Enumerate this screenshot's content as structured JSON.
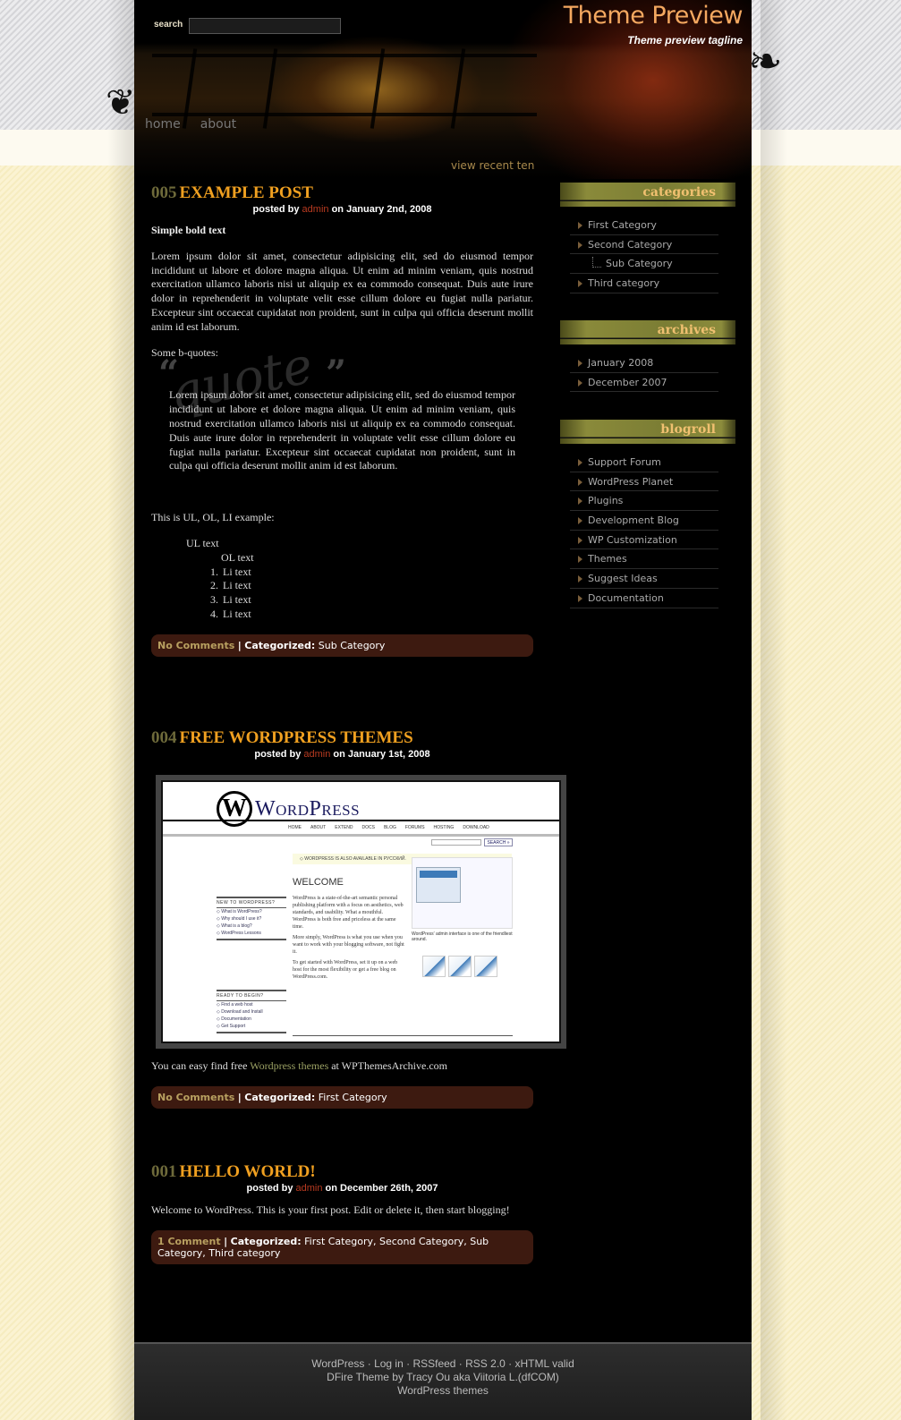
{
  "header": {
    "search_label": "search",
    "search_value": "",
    "site_title": "Theme Preview",
    "tagline": "Theme preview tagline",
    "nav": [
      {
        "label": "home"
      },
      {
        "label": "about"
      }
    ],
    "view_recent": "view recent ten"
  },
  "posts": [
    {
      "number": "005",
      "title": "EXAMPLE POST",
      "meta": {
        "prefix": "posted by",
        "author": "admin",
        "date_text": "on January 2nd, 2008"
      },
      "bold_text": "Simple bold text",
      "paragraph": "Lorem ipsum dolor sit amet, consectetur adipisicing elit, sed do eiusmod tempor incididunt ut labore et dolore magna aliqua. Ut enim ad minim veniam, quis nostrud exercitation ullamco laboris nisi ut aliquip ex ea commodo consequat. Duis aute irure dolor in reprehenderit in voluptate velit esse cillum dolore eu fugiat nulla pariatur. Excepteur sint occaecat cupidatat non proident, sunt in culpa qui officia deserunt mollit anim id est laborum.",
      "bquote_intro": "Some b-quotes:",
      "bquote_watermark": "quote",
      "bquote_text": "Lorem ipsum dolor sit amet, consectetur adipisicing elit, sed do eiusmod tempor incididunt ut labore et dolore magna aliqua. Ut enim ad minim veniam, quis nostrud exercitation ullamco laboris nisi ut aliquip ex ea commodo consequat. Duis aute irure dolor in reprehenderit in voluptate velit esse cillum dolore eu fugiat nulla pariatur. Excepteur sint occaecat cupidatat non proident, sunt in culpa qui officia deserunt mollit anim id est laborum.",
      "list_intro": "This is UL, OL, LI example:",
      "ul_text": "UL text",
      "ol_text": "OL text",
      "li_items": [
        "Li text",
        "Li text",
        "Li text",
        "Li text"
      ],
      "footer": {
        "comments": "No Comments",
        "categorized_label": "Categorized:",
        "categories": "Sub Category"
      }
    },
    {
      "number": "004",
      "title": "FREE WORDPRESS THEMES",
      "meta": {
        "prefix": "posted by",
        "author": "admin",
        "date_text": "on January 1st, 2008"
      },
      "screenshot": {
        "logo_text": "WordPress",
        "nav": [
          "HOME",
          "ABOUT",
          "EXTEND",
          "DOCS",
          "BLOG",
          "FORUMS",
          "HOSTING",
          "DOWNLOAD"
        ],
        "search_button": "SEARCH »",
        "notice": "◇ WORDPRESS IS ALSO AVAILABLE IN РУССКИЙ.",
        "welcome": "WELCOME",
        "body": [
          "WordPress is a state-of-the-art semantic personal publishing platform with a focus on aesthetics, web standards, and usability. What a mouthful. WordPress is both free and priceless at the same time.",
          "More simply, WordPress is what you use when you want to work with your blogging software, not fight it.",
          "To get started with WordPress, set it up on a web host for the most flexibility or get a free blog on WordPress.com."
        ],
        "side1_heading": "NEW TO WORDPRESS?",
        "side1_items": [
          "◇ What is WordPress?",
          "◇ Why should I use it?",
          "◇ What is a blog?",
          "◇ WordPress Lessons"
        ],
        "side2_heading": "READY TO BEGIN?",
        "side2_items": [
          "◇ Find a web host",
          "◇ Download and Install",
          "◇ Documentation",
          "◇ Get Support"
        ],
        "theme_caption": "WordPress' admin interface is one of the friendliest around."
      },
      "text_before": "You can easy find free",
      "link_text": "Wordpress themes",
      "text_after": "at WPThemesArchive.com",
      "footer": {
        "comments": "No Comments",
        "categorized_label": "Categorized:",
        "categories": "First Category"
      }
    },
    {
      "number": "001",
      "title": "HELLO WORLD!",
      "meta": {
        "prefix": "posted by",
        "author": "admin",
        "date_text": "on December 26th, 2007"
      },
      "paragraph": "Welcome to WordPress. This is your first post. Edit or delete it, then start blogging!",
      "footer": {
        "comments": "1 Comment",
        "categorized_label": "Categorized:",
        "categories": "First Category, Second Category, Sub Category, Third category"
      }
    }
  ],
  "sidebar": {
    "categories": {
      "title": "categories",
      "items": [
        {
          "label": "First Category"
        },
        {
          "label": "Second Category"
        },
        {
          "label": "Sub Category"
        },
        {
          "label": "Third category"
        }
      ]
    },
    "archives": {
      "title": "archives",
      "items": [
        {
          "label": "January 2008"
        },
        {
          "label": "December 2007"
        }
      ]
    },
    "blogroll": {
      "title": "blogroll",
      "items": [
        {
          "label": "Support Forum"
        },
        {
          "label": "WordPress Planet"
        },
        {
          "label": "Plugins"
        },
        {
          "label": "Development Blog"
        },
        {
          "label": "WP Customization"
        },
        {
          "label": "Themes"
        },
        {
          "label": "Suggest Ideas"
        },
        {
          "label": "Documentation"
        }
      ]
    }
  },
  "footer": {
    "links": [
      "WordPress",
      "Log in",
      "RSSfeed",
      "RSS 2.0",
      "xHTML valid"
    ],
    "separator": " · ",
    "credit": "DFire Theme by Tracy Ou aka Viitoria L.(dfCOM)",
    "themes_link": "WordPress themes"
  },
  "colors": {
    "post_title": "#f0a020",
    "post_number": "#6e6a3a",
    "author": "#b83a20",
    "post_footer_bg": "#3d1a10",
    "widget_title": "#f0c070"
  }
}
